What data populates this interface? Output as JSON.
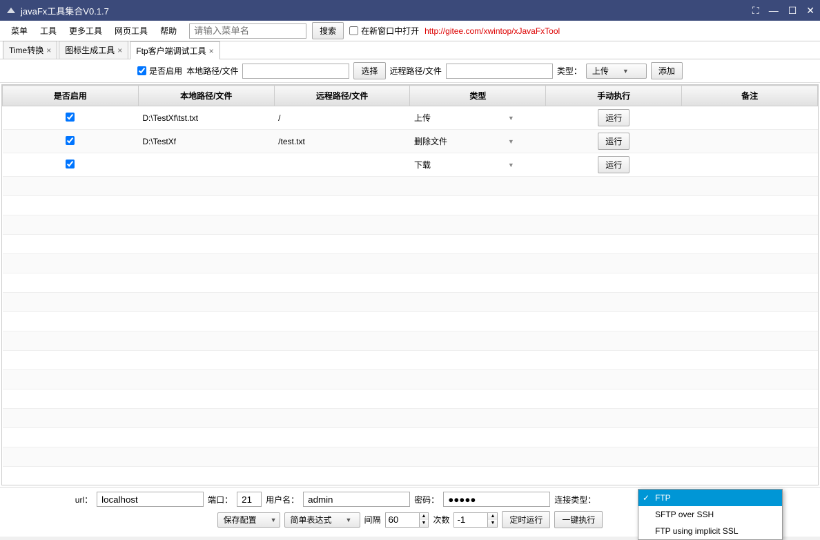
{
  "window": {
    "title": "javaFx工具集合V0.1.7"
  },
  "menubar": {
    "items": [
      "菜单",
      "工具",
      "更多工具",
      "网页工具",
      "帮助"
    ],
    "search_placeholder": "请输入菜单名",
    "search_btn": "搜索",
    "open_new_window": "在新窗口中打开",
    "link": "http://gitee.com/xwintop/xJavaFxTool"
  },
  "tabs": [
    {
      "label": "Time转换"
    },
    {
      "label": "图标生成工具"
    },
    {
      "label": "Ftp客户端调试工具",
      "active": true
    }
  ],
  "toolbar": {
    "enable_label": "是否启用",
    "local_path_label": "本地路径/文件",
    "choose_btn": "选择",
    "remote_path_label": "远程路径/文件",
    "type_label": "类型：",
    "type_value": "上传",
    "add_btn": "添加"
  },
  "table": {
    "headers": [
      "是否启用",
      "本地路径/文件",
      "远程路径/文件",
      "类型",
      "手动执行",
      "备注"
    ],
    "rows": [
      {
        "enabled": true,
        "local": "D:\\TestXf\\tst.txt",
        "remote": "/",
        "type": "上传",
        "exec": "运行",
        "remark": ""
      },
      {
        "enabled": true,
        "local": "D:\\TestXf",
        "remote": "/test.txt",
        "type": "删除文件",
        "exec": "运行",
        "remark": ""
      },
      {
        "enabled": true,
        "local": "",
        "remote": "",
        "type": "下载",
        "exec": "运行",
        "remark": ""
      }
    ]
  },
  "bottom": {
    "url_label": "url：",
    "url_value": "localhost",
    "port_label": "端口：",
    "port_value": "21",
    "user_label": "用户名：",
    "user_value": "admin",
    "pass_label": "密码：",
    "pass_value": "●●●●●",
    "conn_type_label": "连接类型：",
    "save_cfg": "保存配置",
    "expr_type": "简单表达式",
    "interval_label": "间隔",
    "interval_value": "60",
    "count_label": "次数",
    "count_value": "-1",
    "timed_run": "定时运行",
    "run_all": "一键执行"
  },
  "dropdown": {
    "options": [
      "FTP",
      "SFTP over SSH",
      "FTP using implicit SSL"
    ],
    "selected": 0
  }
}
